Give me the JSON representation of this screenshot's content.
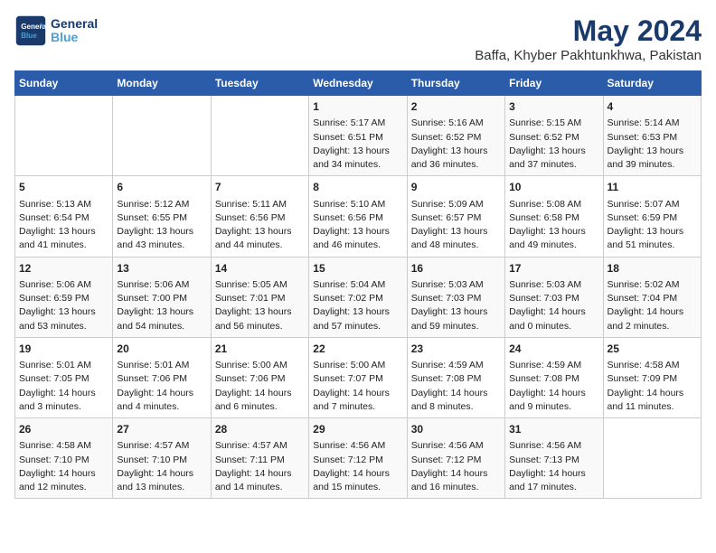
{
  "logo": {
    "line1": "General",
    "line2": "Blue"
  },
  "title": "May 2024",
  "location": "Baffa, Khyber Pakhtunkhwa, Pakistan",
  "weekdays": [
    "Sunday",
    "Monday",
    "Tuesday",
    "Wednesday",
    "Thursday",
    "Friday",
    "Saturday"
  ],
  "weeks": [
    [
      {
        "day": "",
        "sunrise": "",
        "sunset": "",
        "daylight": ""
      },
      {
        "day": "",
        "sunrise": "",
        "sunset": "",
        "daylight": ""
      },
      {
        "day": "",
        "sunrise": "",
        "sunset": "",
        "daylight": ""
      },
      {
        "day": "1",
        "sunrise": "5:17 AM",
        "sunset": "6:51 PM",
        "daylight": "13 hours and 34 minutes."
      },
      {
        "day": "2",
        "sunrise": "5:16 AM",
        "sunset": "6:52 PM",
        "daylight": "13 hours and 36 minutes."
      },
      {
        "day": "3",
        "sunrise": "5:15 AM",
        "sunset": "6:52 PM",
        "daylight": "13 hours and 37 minutes."
      },
      {
        "day": "4",
        "sunrise": "5:14 AM",
        "sunset": "6:53 PM",
        "daylight": "13 hours and 39 minutes."
      }
    ],
    [
      {
        "day": "5",
        "sunrise": "5:13 AM",
        "sunset": "6:54 PM",
        "daylight": "13 hours and 41 minutes."
      },
      {
        "day": "6",
        "sunrise": "5:12 AM",
        "sunset": "6:55 PM",
        "daylight": "13 hours and 43 minutes."
      },
      {
        "day": "7",
        "sunrise": "5:11 AM",
        "sunset": "6:56 PM",
        "daylight": "13 hours and 44 minutes."
      },
      {
        "day": "8",
        "sunrise": "5:10 AM",
        "sunset": "6:56 PM",
        "daylight": "13 hours and 46 minutes."
      },
      {
        "day": "9",
        "sunrise": "5:09 AM",
        "sunset": "6:57 PM",
        "daylight": "13 hours and 48 minutes."
      },
      {
        "day": "10",
        "sunrise": "5:08 AM",
        "sunset": "6:58 PM",
        "daylight": "13 hours and 49 minutes."
      },
      {
        "day": "11",
        "sunrise": "5:07 AM",
        "sunset": "6:59 PM",
        "daylight": "13 hours and 51 minutes."
      }
    ],
    [
      {
        "day": "12",
        "sunrise": "5:06 AM",
        "sunset": "6:59 PM",
        "daylight": "13 hours and 53 minutes."
      },
      {
        "day": "13",
        "sunrise": "5:06 AM",
        "sunset": "7:00 PM",
        "daylight": "13 hours and 54 minutes."
      },
      {
        "day": "14",
        "sunrise": "5:05 AM",
        "sunset": "7:01 PM",
        "daylight": "13 hours and 56 minutes."
      },
      {
        "day": "15",
        "sunrise": "5:04 AM",
        "sunset": "7:02 PM",
        "daylight": "13 hours and 57 minutes."
      },
      {
        "day": "16",
        "sunrise": "5:03 AM",
        "sunset": "7:03 PM",
        "daylight": "13 hours and 59 minutes."
      },
      {
        "day": "17",
        "sunrise": "5:03 AM",
        "sunset": "7:03 PM",
        "daylight": "14 hours and 0 minutes."
      },
      {
        "day": "18",
        "sunrise": "5:02 AM",
        "sunset": "7:04 PM",
        "daylight": "14 hours and 2 minutes."
      }
    ],
    [
      {
        "day": "19",
        "sunrise": "5:01 AM",
        "sunset": "7:05 PM",
        "daylight": "14 hours and 3 minutes."
      },
      {
        "day": "20",
        "sunrise": "5:01 AM",
        "sunset": "7:06 PM",
        "daylight": "14 hours and 4 minutes."
      },
      {
        "day": "21",
        "sunrise": "5:00 AM",
        "sunset": "7:06 PM",
        "daylight": "14 hours and 6 minutes."
      },
      {
        "day": "22",
        "sunrise": "5:00 AM",
        "sunset": "7:07 PM",
        "daylight": "14 hours and 7 minutes."
      },
      {
        "day": "23",
        "sunrise": "4:59 AM",
        "sunset": "7:08 PM",
        "daylight": "14 hours and 8 minutes."
      },
      {
        "day": "24",
        "sunrise": "4:59 AM",
        "sunset": "7:08 PM",
        "daylight": "14 hours and 9 minutes."
      },
      {
        "day": "25",
        "sunrise": "4:58 AM",
        "sunset": "7:09 PM",
        "daylight": "14 hours and 11 minutes."
      }
    ],
    [
      {
        "day": "26",
        "sunrise": "4:58 AM",
        "sunset": "7:10 PM",
        "daylight": "14 hours and 12 minutes."
      },
      {
        "day": "27",
        "sunrise": "4:57 AM",
        "sunset": "7:10 PM",
        "daylight": "14 hours and 13 minutes."
      },
      {
        "day": "28",
        "sunrise": "4:57 AM",
        "sunset": "7:11 PM",
        "daylight": "14 hours and 14 minutes."
      },
      {
        "day": "29",
        "sunrise": "4:56 AM",
        "sunset": "7:12 PM",
        "daylight": "14 hours and 15 minutes."
      },
      {
        "day": "30",
        "sunrise": "4:56 AM",
        "sunset": "7:12 PM",
        "daylight": "14 hours and 16 minutes."
      },
      {
        "day": "31",
        "sunrise": "4:56 AM",
        "sunset": "7:13 PM",
        "daylight": "14 hours and 17 minutes."
      },
      {
        "day": "",
        "sunrise": "",
        "sunset": "",
        "daylight": ""
      }
    ]
  ]
}
